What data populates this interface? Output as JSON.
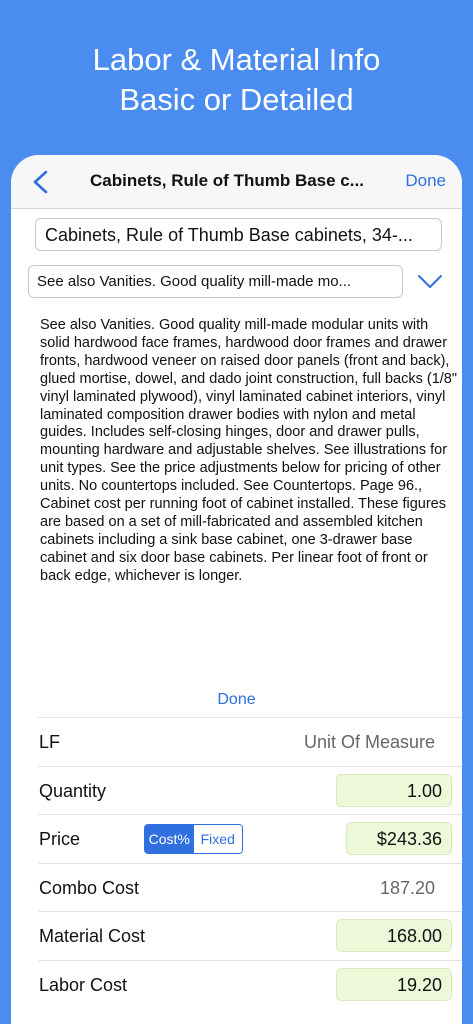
{
  "promo": {
    "line1": "Labor & Material Info",
    "line2": "Basic or Detailed"
  },
  "navbar": {
    "title": "Cabinets, Rule of Thumb Base c...",
    "done_label": "Done"
  },
  "item": {
    "title_value": "Cabinets, Rule of Thumb Base cabinets, 34-...",
    "description_value": "See also Vanities. Good quality mill-made mo...",
    "description_full": "See also Vanities. Good quality mill-made modular units with solid hardwood face frames, hardwood door frames and drawer fronts, hardwood veneer on raised door panels (front and back), glued mortise, dowel, and dado joint construction, full backs (1/8\" vinyl laminated plywood), vinyl laminated cabinet interiors, vinyl laminated composition drawer bodies with nylon and metal guides. Includes self-closing hinges, door and drawer pulls, mounting hardware and adjustable shelves. See illustrations for unit types. See the price adjustments below for pricing of other units. No countertops included. See Countertops. Page 96., Cabinet cost per running foot of cabinet installed. These figures are based on a set of mill-fabricated and assembled kitchen cabinets including a sink base cabinet, one 3-drawer base cabinet and six door base cabinets. Per linear foot of front or back edge, whichever is longer.",
    "description_done_label": "Done"
  },
  "details": {
    "unit": {
      "label": "LF",
      "value": "Unit Of Measure"
    },
    "quantity": {
      "label": "Quantity",
      "value": "1.00"
    },
    "price": {
      "label": "Price",
      "value": "$243.36",
      "seg_cost": "Cost%",
      "seg_fixed": "Fixed",
      "selected": "Cost%"
    },
    "combo": {
      "label": "Combo Cost",
      "value": "187.20"
    },
    "material": {
      "label": "Material Cost",
      "value": "168.00"
    },
    "labor": {
      "label": "Labor Cost",
      "value": "19.20"
    }
  },
  "colors": {
    "background": "#4a8cf0",
    "accent": "#2f6fdf",
    "input_green": "#ecf8d8"
  },
  "icons": {
    "back": "chevron-left-icon",
    "dropdown": "chevron-down-icon"
  }
}
